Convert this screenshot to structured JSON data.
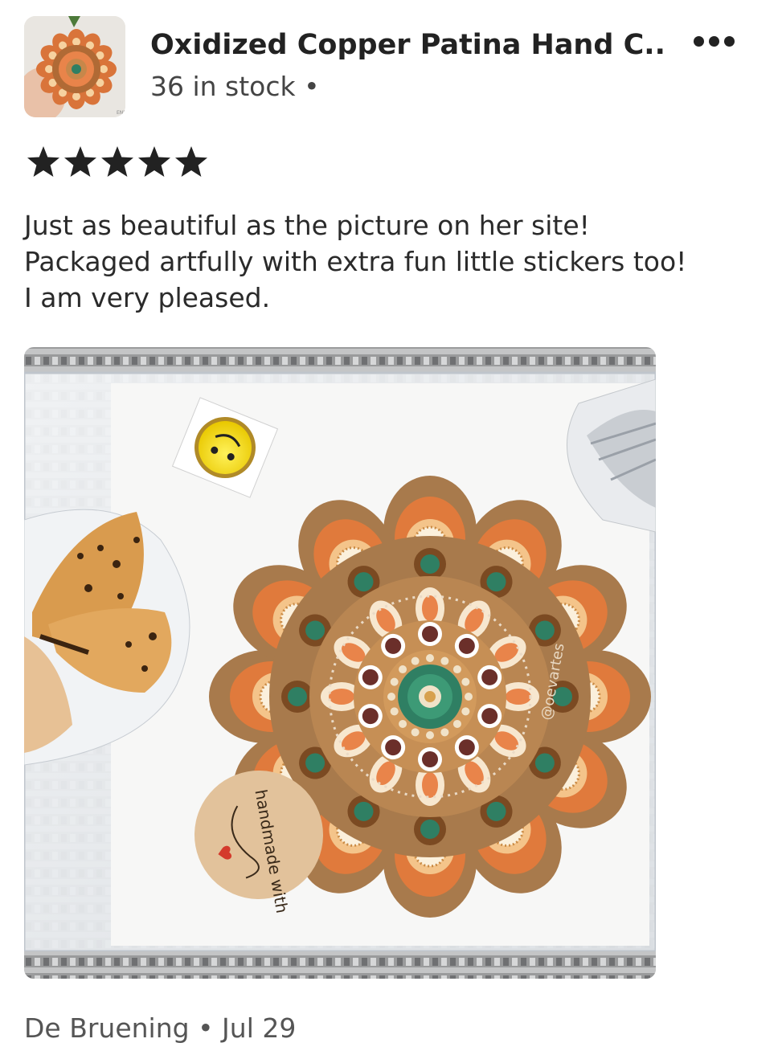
{
  "listing": {
    "title": "Oxidized Copper Patina Hand C...",
    "stock": "36 in stock •",
    "thumbnail_icon": "mandala-thumbnail"
  },
  "menu": {
    "icon": "more-options-icon"
  },
  "review": {
    "rating": 5,
    "rating_max": 5,
    "lines": [
      "Just as beautiful as the picture on her site!",
      "Packaged artfully with extra fun little stickers too!",
      "I am very pleased."
    ],
    "photo_sticker_text": "@oevartes",
    "photo_card_text": "handmade with"
  },
  "footer": {
    "author": "De Bruening",
    "separator": "•",
    "date": "Jul 29"
  },
  "colors": {
    "star": "#222222",
    "orange": "#e07a3c",
    "brown": "#8a5a30",
    "teal": "#2f7f63",
    "tan": "#c79a63"
  }
}
